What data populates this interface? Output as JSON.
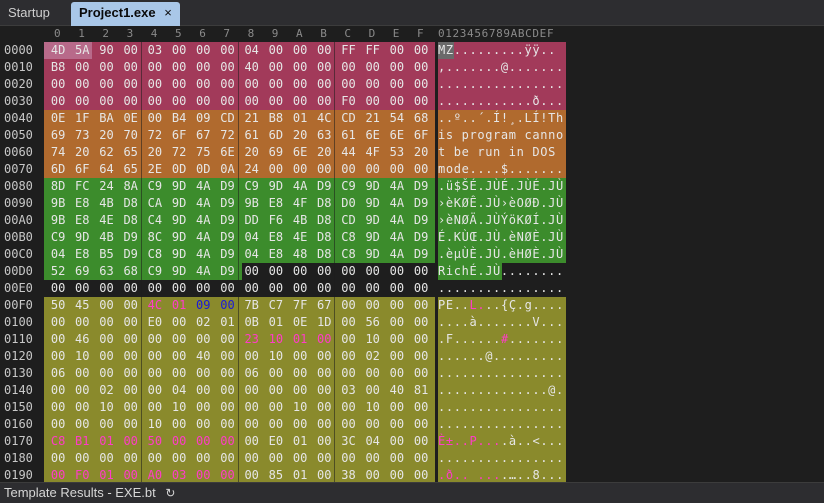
{
  "tabs": [
    {
      "label": "Startup",
      "active": false
    },
    {
      "label": "Project1.exe",
      "active": true,
      "close": "×"
    }
  ],
  "column_header": {
    "hex": [
      "0",
      "1",
      "2",
      "3",
      "4",
      "5",
      "6",
      "7",
      "8",
      "9",
      "A",
      "B",
      "C",
      "D",
      "E",
      "F"
    ],
    "ascii": "0123456789ABCDEF"
  },
  "colors": {
    "dos_header": "#a23a5a",
    "dos_header_selected": "#b86a8a",
    "dos_stub": "#b06a2e",
    "rich_header": "#3c8c2c",
    "nt_headers": "#8a8a2c",
    "highlight_pink": "#ff3cc8",
    "highlight_blue": "#1a1ad8",
    "background": "#1e1e1e"
  },
  "rows": [
    {
      "addr": "0000",
      "bytes": [
        "4D",
        "5A",
        "90",
        "00",
        "03",
        "00",
        "00",
        "00",
        "04",
        "00",
        "00",
        "00",
        "FF",
        "FF",
        "00",
        "00"
      ],
      "ascii": "MZ.........ÿÿ..",
      "fill": "dos_header",
      "sel": [
        0,
        1
      ]
    },
    {
      "addr": "0010",
      "bytes": [
        "B8",
        "00",
        "00",
        "00",
        "00",
        "00",
        "00",
        "00",
        "40",
        "00",
        "00",
        "00",
        "00",
        "00",
        "00",
        "00"
      ],
      "ascii": ",.......@.......",
      "fill": "dos_header"
    },
    {
      "addr": "0020",
      "bytes": [
        "00",
        "00",
        "00",
        "00",
        "00",
        "00",
        "00",
        "00",
        "00",
        "00",
        "00",
        "00",
        "00",
        "00",
        "00",
        "00"
      ],
      "ascii": "................",
      "fill": "dos_header"
    },
    {
      "addr": "0030",
      "bytes": [
        "00",
        "00",
        "00",
        "00",
        "00",
        "00",
        "00",
        "00",
        "00",
        "00",
        "00",
        "00",
        "F0",
        "00",
        "00",
        "00"
      ],
      "ascii": "............ð...",
      "fill": "dos_header"
    },
    {
      "addr": "0040",
      "bytes": [
        "0E",
        "1F",
        "BA",
        "0E",
        "00",
        "B4",
        "09",
        "CD",
        "21",
        "B8",
        "01",
        "4C",
        "CD",
        "21",
        "54",
        "68"
      ],
      "ascii": "..º..´.Í!¸.LÍ!Th",
      "fill": "dos_stub"
    },
    {
      "addr": "0050",
      "bytes": [
        "69",
        "73",
        "20",
        "70",
        "72",
        "6F",
        "67",
        "72",
        "61",
        "6D",
        "20",
        "63",
        "61",
        "6E",
        "6E",
        "6F"
      ],
      "ascii": "is program canno",
      "fill": "dos_stub"
    },
    {
      "addr": "0060",
      "bytes": [
        "74",
        "20",
        "62",
        "65",
        "20",
        "72",
        "75",
        "6E",
        "20",
        "69",
        "6E",
        "20",
        "44",
        "4F",
        "53",
        "20"
      ],
      "ascii": "t be run in DOS ",
      "fill": "dos_stub"
    },
    {
      "addr": "0070",
      "bytes": [
        "6D",
        "6F",
        "64",
        "65",
        "2E",
        "0D",
        "0D",
        "0A",
        "24",
        "00",
        "00",
        "00",
        "00",
        "00",
        "00",
        "00"
      ],
      "ascii": "mode....$.......",
      "fill": "dos_stub"
    },
    {
      "addr": "0080",
      "bytes": [
        "8D",
        "FC",
        "24",
        "8A",
        "C9",
        "9D",
        "4A",
        "D9",
        "C9",
        "9D",
        "4A",
        "D9",
        "C9",
        "9D",
        "4A",
        "D9"
      ],
      "ascii": ".ü$ŠÉ.JÙÉ.JÙÉ.JÙ",
      "fill": "rich_header"
    },
    {
      "addr": "0090",
      "bytes": [
        "9B",
        "E8",
        "4B",
        "D8",
        "CA",
        "9D",
        "4A",
        "D9",
        "9B",
        "E8",
        "4F",
        "D8",
        "D0",
        "9D",
        "4A",
        "D9"
      ],
      "ascii": "›èKØÊ.JÙ›èOØÐ.JÙ",
      "fill": "rich_header"
    },
    {
      "addr": "00A0",
      "bytes": [
        "9B",
        "E8",
        "4E",
        "D8",
        "C4",
        "9D",
        "4A",
        "D9",
        "DD",
        "F6",
        "4B",
        "D8",
        "CD",
        "9D",
        "4A",
        "D9"
      ],
      "ascii": "›èNØÄ.JÙÝöKØÍ.JÙ",
      "fill": "rich_header"
    },
    {
      "addr": "00B0",
      "bytes": [
        "C9",
        "9D",
        "4B",
        "D9",
        "8C",
        "9D",
        "4A",
        "D9",
        "04",
        "E8",
        "4E",
        "D8",
        "C8",
        "9D",
        "4A",
        "D9"
      ],
      "ascii": "É.KÙŒ.JÙ.èNØÈ.JÙ",
      "fill": "rich_header"
    },
    {
      "addr": "00C0",
      "bytes": [
        "04",
        "E8",
        "B5",
        "D9",
        "C8",
        "9D",
        "4A",
        "D9",
        "04",
        "E8",
        "48",
        "D8",
        "C8",
        "9D",
        "4A",
        "D9"
      ],
      "ascii": ".èµÙÈ.JÙ.èHØÈ.JÙ",
      "fill": "rich_header"
    },
    {
      "addr": "00D0",
      "bytes": [
        "52",
        "69",
        "63",
        "68",
        "C9",
        "9D",
        "4A",
        "D9",
        "00",
        "00",
        "00",
        "00",
        "00",
        "00",
        "00",
        "00"
      ],
      "ascii": "RichÉ.JÙ........",
      "fill": "rich_header",
      "fill_count": 8
    },
    {
      "addr": "00E0",
      "bytes": [
        "00",
        "00",
        "00",
        "00",
        "00",
        "00",
        "00",
        "00",
        "00",
        "00",
        "00",
        "00",
        "00",
        "00",
        "00",
        "00"
      ],
      "ascii": "................",
      "fill": "none"
    },
    {
      "addr": "00F0",
      "bytes": [
        "50",
        "45",
        "00",
        "00",
        "4C",
        "01",
        "09",
        "00",
        "7B",
        "C7",
        "7F",
        "67",
        "00",
        "00",
        "00",
        "00"
      ],
      "ascii": "PE..L...{Ç.g....",
      "fill": "nt_headers",
      "pink": [
        4,
        5
      ],
      "blue": [
        6,
        7
      ],
      "ascii_pink": [
        4,
        5
      ]
    },
    {
      "addr": "0100",
      "bytes": [
        "00",
        "00",
        "00",
        "00",
        "E0",
        "00",
        "02",
        "01",
        "0B",
        "01",
        "0E",
        "1D",
        "00",
        "56",
        "00",
        "00"
      ],
      "ascii": "....à.......V...",
      "fill": "nt_headers"
    },
    {
      "addr": "0110",
      "bytes": [
        "00",
        "46",
        "00",
        "00",
        "00",
        "00",
        "00",
        "00",
        "23",
        "10",
        "01",
        "00",
        "00",
        "10",
        "00",
        "00"
      ],
      "ascii": ".F......#.......",
      "fill": "nt_headers",
      "pink": [
        8,
        9,
        10,
        11
      ],
      "ascii_pink": [
        8
      ]
    },
    {
      "addr": "0120",
      "bytes": [
        "00",
        "10",
        "00",
        "00",
        "00",
        "00",
        "40",
        "00",
        "00",
        "10",
        "00",
        "00",
        "00",
        "02",
        "00",
        "00"
      ],
      "ascii": "......@.........",
      "fill": "nt_headers"
    },
    {
      "addr": "0130",
      "bytes": [
        "06",
        "00",
        "00",
        "00",
        "00",
        "00",
        "00",
        "00",
        "06",
        "00",
        "00",
        "00",
        "00",
        "00",
        "00",
        "00"
      ],
      "ascii": "................",
      "fill": "nt_headers"
    },
    {
      "addr": "0140",
      "bytes": [
        "00",
        "00",
        "02",
        "00",
        "00",
        "04",
        "00",
        "00",
        "00",
        "00",
        "00",
        "00",
        "03",
        "00",
        "40",
        "81"
      ],
      "ascii": "..............@.",
      "fill": "nt_headers"
    },
    {
      "addr": "0150",
      "bytes": [
        "00",
        "00",
        "10",
        "00",
        "00",
        "10",
        "00",
        "00",
        "00",
        "00",
        "10",
        "00",
        "00",
        "10",
        "00",
        "00"
      ],
      "ascii": "................",
      "fill": "nt_headers"
    },
    {
      "addr": "0160",
      "bytes": [
        "00",
        "00",
        "00",
        "00",
        "10",
        "00",
        "00",
        "00",
        "00",
        "00",
        "00",
        "00",
        "00",
        "00",
        "00",
        "00"
      ],
      "ascii": "................",
      "fill": "nt_headers"
    },
    {
      "addr": "0170",
      "bytes": [
        "C8",
        "B1",
        "01",
        "00",
        "50",
        "00",
        "00",
        "00",
        "00",
        "E0",
        "01",
        "00",
        "3C",
        "04",
        "00",
        "00"
      ],
      "ascii": "È±..P....à..<...",
      "fill": "nt_headers",
      "pink": [
        0,
        1,
        2,
        3,
        4,
        5,
        6,
        7
      ],
      "ascii_pink": [
        0,
        1,
        2,
        3,
        4,
        5,
        6,
        7
      ]
    },
    {
      "addr": "0180",
      "bytes": [
        "00",
        "00",
        "00",
        "00",
        "00",
        "00",
        "00",
        "00",
        "00",
        "00",
        "00",
        "00",
        "00",
        "00",
        "00",
        "00"
      ],
      "ascii": "................",
      "fill": "nt_headers"
    },
    {
      "addr": "0190",
      "bytes": [
        "00",
        "F0",
        "01",
        "00",
        "A0",
        "03",
        "00",
        "00",
        "00",
        "85",
        "01",
        "00",
        "38",
        "00",
        "00",
        "00"
      ],
      "ascii": ".ð.. ....…..8...",
      "fill": "nt_headers",
      "pink": [
        0,
        1,
        2,
        3,
        4,
        5,
        6,
        7
      ],
      "ascii_pink": [
        0,
        1,
        2,
        3,
        4,
        5,
        6,
        7
      ]
    }
  ],
  "status": {
    "label": "Template Results - EXE.bt",
    "refresh_icon": "↻"
  }
}
